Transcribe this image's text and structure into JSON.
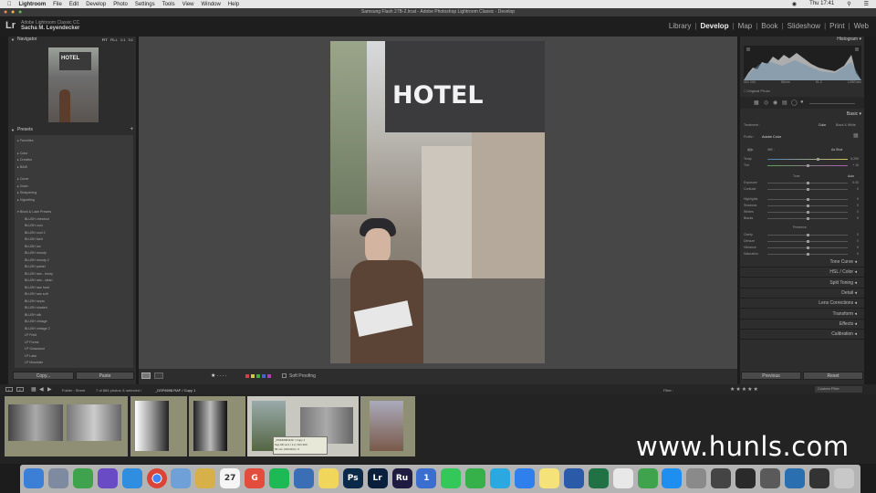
{
  "menubar": {
    "apple": "",
    "app": "Lightroom",
    "items": [
      "File",
      "Edit",
      "Develop",
      "Photo",
      "Settings",
      "Tools",
      "View",
      "Window",
      "Help"
    ],
    "clock": "Thu 17:41"
  },
  "window_title": "Samsung Flash 27B-2.lrcat - Adobe Photoshop Lightroom Classic - Develop",
  "identity": {
    "product": "Adobe Lightroom Classic CC",
    "user": "Sacha M. Leyendecker",
    "logo": "Lr"
  },
  "modules": [
    "Library",
    "Develop",
    "Map",
    "Book",
    "Slideshow",
    "Print",
    "Web"
  ],
  "active_module": "Develop",
  "navigator": {
    "title": "Navigator",
    "zoom_options": [
      "FIT",
      "FILL",
      "1:1",
      "3:1"
    ]
  },
  "presets": {
    "title": "Presets",
    "groups": [
      {
        "label": "Favorites"
      },
      {
        "label": "Color"
      },
      {
        "label": "Creative"
      },
      {
        "label": "B&W"
      },
      {
        "label": "Curve"
      },
      {
        "label": "Grain"
      },
      {
        "label": "Sharpening"
      },
      {
        "label": "Vignetting"
      }
    ],
    "open_group": "Blush & Lake Presets",
    "items": [
      "BLUSH chestnut",
      "BLUSH cool",
      "BLUSH cool 2",
      "BLUSH faint",
      "BLUSH ice",
      "BLUSH moody",
      "BLUSH moody 2",
      "BLUSH pastel",
      "BLUSH raw - blurry",
      "BLUSH raw - clean",
      "BLUSH raw hard",
      "BLUSH raw soft",
      "BLUSH sepia",
      "BLUSH shaded",
      "BLUSH silk",
      "BLUSH vintage",
      "BLUSH vintage 2",
      "LP Field",
      "LP Forest",
      "LP Grassland",
      "LP Lake",
      "LP Mountain"
    ]
  },
  "left_buttons": {
    "copy": "Copy...",
    "paste": "Paste"
  },
  "photo": {
    "sign_text": "HOTEL"
  },
  "toolbar": {
    "soft_proofing": "Soft Proofing"
  },
  "histogram": {
    "title": "Histogram",
    "info": [
      "ISO 200",
      "56mm",
      "f/1.2",
      "1/250 sec"
    ],
    "original": "Original Photo"
  },
  "basic": {
    "title": "Basic",
    "treatment_label": "Treatment :",
    "treatment_options": [
      "Color",
      "Black & White"
    ],
    "profile_label": "Profile :",
    "profile_value": "Adobe Color",
    "wb_label": "WB :",
    "wb_value": "As Shot",
    "temp": {
      "label": "Temp",
      "value": "5,250"
    },
    "tint": {
      "label": "Tint",
      "value": "+ 10"
    },
    "tone_label": "Tone",
    "auto_label": "Auto",
    "tone": [
      {
        "label": "Exposure",
        "value": "0.00"
      },
      {
        "label": "Contrast",
        "value": "0"
      },
      {
        "label": "Highlights",
        "value": "0"
      },
      {
        "label": "Shadows",
        "value": "0"
      },
      {
        "label": "Whites",
        "value": "0"
      },
      {
        "label": "Blacks",
        "value": "0"
      }
    ],
    "presence_label": "Presence",
    "presence": [
      {
        "label": "Clarity",
        "value": "0"
      },
      {
        "label": "Dehaze",
        "value": "0"
      },
      {
        "label": "Vibrance",
        "value": "0"
      },
      {
        "label": "Saturation",
        "value": "0"
      }
    ]
  },
  "right_panels": [
    "Tone Curve",
    "HSL / Color",
    "Split Toning",
    "Detail",
    "Lens Corrections",
    "Transform",
    "Effects",
    "Calibration"
  ],
  "right_buttons": {
    "previous": "Previous",
    "reset": "Reset"
  },
  "filmstrip": {
    "pages": [
      "1",
      "2"
    ],
    "source": "Folder : Street",
    "count": "7 of 884 photos /1 selected /",
    "filename": "_DSF6698.RAF / Copy 1",
    "filter_label": "Filter :",
    "filter_value": "Custom Filter",
    "tooltip": [
      "_DSF6698.RAF / Copy 1",
      "Sep 6th at 4 / 1.2, ISO 200",
      "56 mm (f/2/2/2/2) / 2"
    ]
  },
  "dock": {
    "icons": [
      "finder-icon",
      "launchpad-icon",
      "evernote-icon",
      "siri-icon",
      "safari-icon",
      "chrome-icon",
      "preview-icon",
      "notes-icon",
      "calendar-icon",
      "google-icon",
      "spotify-icon",
      "keynote-icon",
      "stickies-icon",
      "photoshop-icon",
      "lightroom-icon",
      "rush-icon",
      "onepassword-icon",
      "messages-icon",
      "facetime-icon",
      "skype-icon",
      "messenger-icon",
      "notes2-icon",
      "word-icon",
      "excel-icon",
      "textedit-icon",
      "numbers-icon",
      "appstore-icon",
      "settings-icon",
      "printer-icon",
      "activity-icon",
      "tools-icon",
      "quicktime-icon",
      "screen-icon",
      "trash-icon"
    ],
    "calendar_day": "27",
    "labels": {
      "ps": "Ps",
      "lr": "Lr",
      "ru": "Ru",
      "g": "G",
      "one": "1"
    }
  },
  "watermark": "www.hunls.com",
  "colors": {
    "accent_green": "#8f8f76",
    "panel": "#2d2d2d",
    "bg": "#474747"
  }
}
